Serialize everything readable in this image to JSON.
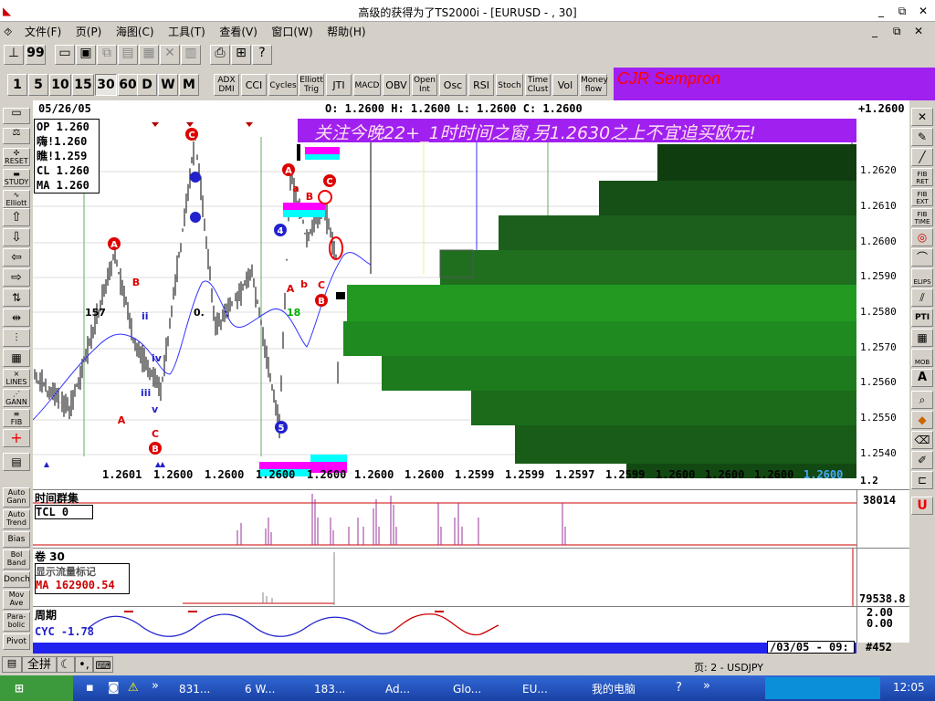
{
  "window": {
    "title": "高级的获得为了TS2000i - [EURUSD - , 30]",
    "min": "_",
    "restore": "⧉",
    "close": "✕"
  },
  "menu": [
    "文件(F)",
    "页(P)",
    "海图(C)",
    "工具(T)",
    "查看(V)",
    "窗口(W)",
    "帮助(H)"
  ],
  "intervals": [
    "1",
    "5",
    "10",
    "15",
    "30",
    "60",
    "D",
    "W",
    "M"
  ],
  "indicators": [
    "ADX DMI",
    "CCI",
    "Cycles",
    "Elliott Trig",
    "JTI",
    "MACD",
    "OBV",
    "Open Int",
    "Osc",
    "RSI",
    "Stoch",
    "Time Clust",
    "Vol",
    "Money flow"
  ],
  "brand_panel": "CJR Sempron",
  "chart": {
    "date": "05/26/05",
    "ohlc": "O: 1.2600 H: 1.2600 L: 1.2600 C: 1.2600",
    "last_price": "+1.2600",
    "banner": "关注今晚22+_1时时间之窗,另1.2630之上不宜追买欧元!",
    "info": [
      "OP 1.260",
      "嗨!1.260",
      "瞧!1.259",
      "CL 1.260",
      "MA 1.260"
    ],
    "price_labels": [
      "1.2620",
      "1.2610",
      "1.2600",
      "1.2590",
      "1.2580",
      "1.2570",
      "1.2560",
      "1.2550",
      "1.2540"
    ],
    "bottom_prices": [
      "1.2601",
      "1.2600",
      "1.2600",
      "1.2600",
      "1.2600",
      "1.2600",
      "1.2600",
      "1.2599",
      "1.2599",
      "1.2597",
      "1.2599",
      "1.2600",
      "1.2600",
      "1.2600",
      "1.2600"
    ],
    "scale_bottom": "1.2",
    "annotations": {
      "n157": "157",
      "n0": "0.",
      "n18": "18",
      "ii": "ii",
      "iii": "iii",
      "iv": "iv",
      "v": "v"
    }
  },
  "panes": {
    "p1": {
      "title": "时间群集",
      "tcl": "TCL 0",
      "value": "38014"
    },
    "p2": {
      "title": "卷 30",
      "sub": "显示流量标记",
      "ma": "MA  162900.54",
      "value": "79538.8"
    },
    "p3": {
      "title": "周期",
      "cyc": "CYC -1.78",
      "v1": "2.00",
      "v2": "0.00"
    }
  },
  "leftbar": [
    "Auto Gann",
    "Auto Trend",
    "Bias",
    "Bol Band",
    "Donch",
    "Mov Ave",
    "Para-bolic",
    "Pivot"
  ],
  "rightbar": [
    "FIB RET",
    "FIB EXT",
    "FIB TIME",
    "ELIPS",
    "PTI",
    "MOB"
  ],
  "statusbar": {
    "left": "全拼",
    "date": "/03/05 - 09:",
    "count": "#452",
    "page": "页: 2 - USDJPY"
  },
  "taskbar": {
    "items": [
      "831...",
      "6 W...",
      "183...",
      "Ad...",
      "Glo...",
      "EU...",
      "我的电脑"
    ],
    "clock": "12:05"
  },
  "colors": {
    "purple": "#a020f0",
    "green_dark": "#0f3d0f",
    "green_mid": "#1f6f1f",
    "green_light": "#22aa22"
  }
}
